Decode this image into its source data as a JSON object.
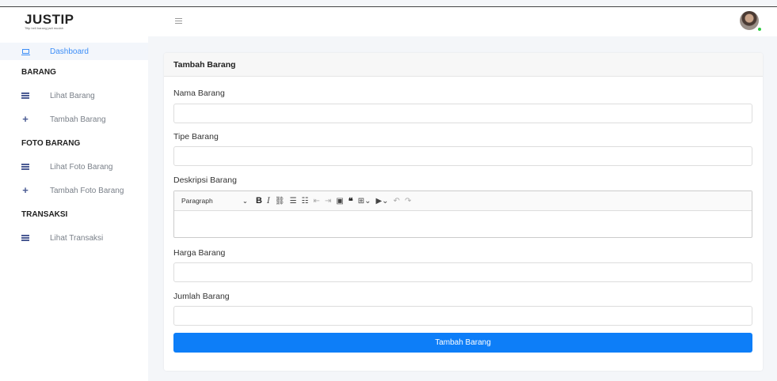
{
  "brand": {
    "name": "JUSTIP",
    "tagline": "Titip beli barang jadi mudah"
  },
  "sidebar": {
    "dashboard": "Dashboard",
    "sections": [
      {
        "title": "BARANG",
        "items": [
          {
            "label": "Lihat Barang",
            "icon": "list-icon"
          },
          {
            "label": "Tambah Barang",
            "icon": "plus-icon"
          }
        ]
      },
      {
        "title": "FOTO BARANG",
        "items": [
          {
            "label": "Lihat Foto Barang",
            "icon": "list-icon"
          },
          {
            "label": "Tambah Foto Barang",
            "icon": "plus-icon"
          }
        ]
      },
      {
        "title": "TRANSAKSI",
        "items": [
          {
            "label": "Lihat Transaksi",
            "icon": "list-icon"
          }
        ]
      }
    ]
  },
  "form": {
    "title": "Tambah Barang",
    "fields": {
      "nama": "Nama Barang",
      "tipe": "Tipe Barang",
      "deskripsi": "Deskripsi Barang",
      "harga": "Harga Barang",
      "jumlah": "Jumlah Barang"
    },
    "editor": {
      "paragraph": "Paragraph"
    },
    "submit": "Tambah Barang"
  },
  "colors": {
    "accent": "#0d7ef8",
    "active_nav": "#3d8ef7",
    "status_online": "#2ecc40"
  }
}
